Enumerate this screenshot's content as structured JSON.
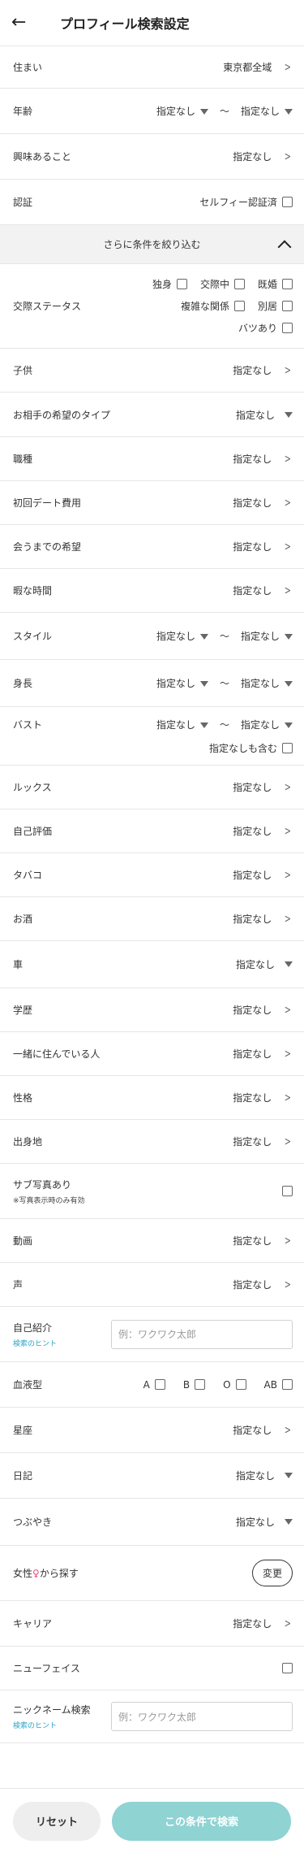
{
  "header": {
    "title": "プロフィール検索設定",
    "back_icon": "←"
  },
  "common": {
    "none": "指定なし",
    "tilde": "〜"
  },
  "rows": {
    "residence": {
      "label": "住まい",
      "value": "東京都全域"
    },
    "age": {
      "label": "年齢"
    },
    "interests": {
      "label": "興味あること"
    },
    "verify": {
      "label": "認証",
      "value": "セルフィー認証済"
    }
  },
  "section": {
    "label": "さらに条件を絞り込む"
  },
  "relationship": {
    "label": "交際ステータス",
    "options": [
      "独身",
      "交際中",
      "既婚",
      "複雑な関係",
      "別居",
      "バツあり"
    ]
  },
  "list_a": [
    {
      "label": "子供"
    },
    {
      "label": "お相手の希望のタイプ"
    },
    {
      "label": "職種"
    },
    {
      "label": "初回デート費用"
    },
    {
      "label": "会うまでの希望"
    },
    {
      "label": "暇な時間"
    }
  ],
  "style": {
    "label": "スタイル"
  },
  "height": {
    "label": "身長"
  },
  "bust": {
    "label": "バスト",
    "include_none": "指定なしも含む"
  },
  "list_b": [
    {
      "label": "ルックス"
    },
    {
      "label": "自己評価"
    },
    {
      "label": "タバコ"
    },
    {
      "label": "お酒"
    },
    {
      "label": "車"
    },
    {
      "label": "学歴"
    },
    {
      "label": "一緒に住んでいる人"
    },
    {
      "label": "性格"
    },
    {
      "label": "出身地"
    }
  ],
  "sub_photo": {
    "label": "サブ写真あり",
    "note": "※写真表示時のみ有効"
  },
  "video": {
    "label": "動画"
  },
  "voice": {
    "label": "声"
  },
  "intro": {
    "label": "自己紹介",
    "hint": "検索のヒント",
    "placeholder": "例：ワクワク太郎"
  },
  "blood": {
    "label": "血液型",
    "options": [
      "A",
      "B",
      "O",
      "AB"
    ]
  },
  "zodiac": {
    "label": "星座"
  },
  "diary": {
    "label": "日記"
  },
  "tweet": {
    "label": "つぶやき"
  },
  "female_search": {
    "label_pre": "女性",
    "symbol": "♀",
    "label_post": "から探す",
    "button": "変更"
  },
  "carrier": {
    "label": "キャリア"
  },
  "newface": {
    "label": "ニューフェイス"
  },
  "nickname": {
    "label": "ニックネーム検索",
    "hint": "検索のヒント",
    "placeholder": "例：ワクワク太郎"
  },
  "footer": {
    "reset": "リセット",
    "search": "この条件で検索"
  }
}
